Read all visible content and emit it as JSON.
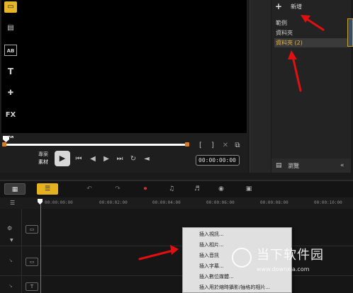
{
  "preview": {
    "mode_project": "專案",
    "mode_clip": "素材",
    "play": "▶",
    "timecode": "00:00:00:00",
    "ctrl_icons": [
      "go-start-icon",
      "prev-frame-icon",
      "next-frame-icon",
      "go-end-icon",
      "repeat-icon",
      "volume-icon"
    ],
    "mark_in": "[",
    "mark_out": "]",
    "split": "✕",
    "enlarge": "⧉"
  },
  "library": {
    "add": "+",
    "new_label": "新增",
    "tree": [
      "範例",
      "資料夾",
      "資料夾 (2)"
    ],
    "browse_label": "瀏覽",
    "collapse": "«",
    "tool_icons": [
      "media-icon",
      "instant-project-icon",
      "transition-icon",
      "title-icon",
      "graphic-icon",
      "fx-icon",
      "path-icon"
    ],
    "tool_glyphs": [
      "▭",
      "▤",
      "AB",
      "T",
      "✚",
      "FX",
      "↝"
    ]
  },
  "timeline_toolbar": {
    "storyboard": "▦",
    "timeline": "☰",
    "undo": "↶",
    "redo": "↷",
    "record": "⏺",
    "sound_mixer": "♫",
    "auto_music": "♬",
    "motion": "◉",
    "subtitle": "▣"
  },
  "ruler": {
    "ticks": [
      "00:00:00:00",
      "00:00:02:00",
      "00:00:04:00",
      "00:00:06:00",
      "00:00:08:00",
      "00:00:10:00"
    ]
  },
  "context_menu": {
    "items": [
      "插入視訊...",
      "插入相片...",
      "插入音訊",
      "插入字幕...",
      "插入數位媒體...",
      "插入用於縮時攝影/抽格的相片..."
    ]
  },
  "watermark": {
    "title": "当下软件园",
    "url": "www.downxia.com"
  }
}
